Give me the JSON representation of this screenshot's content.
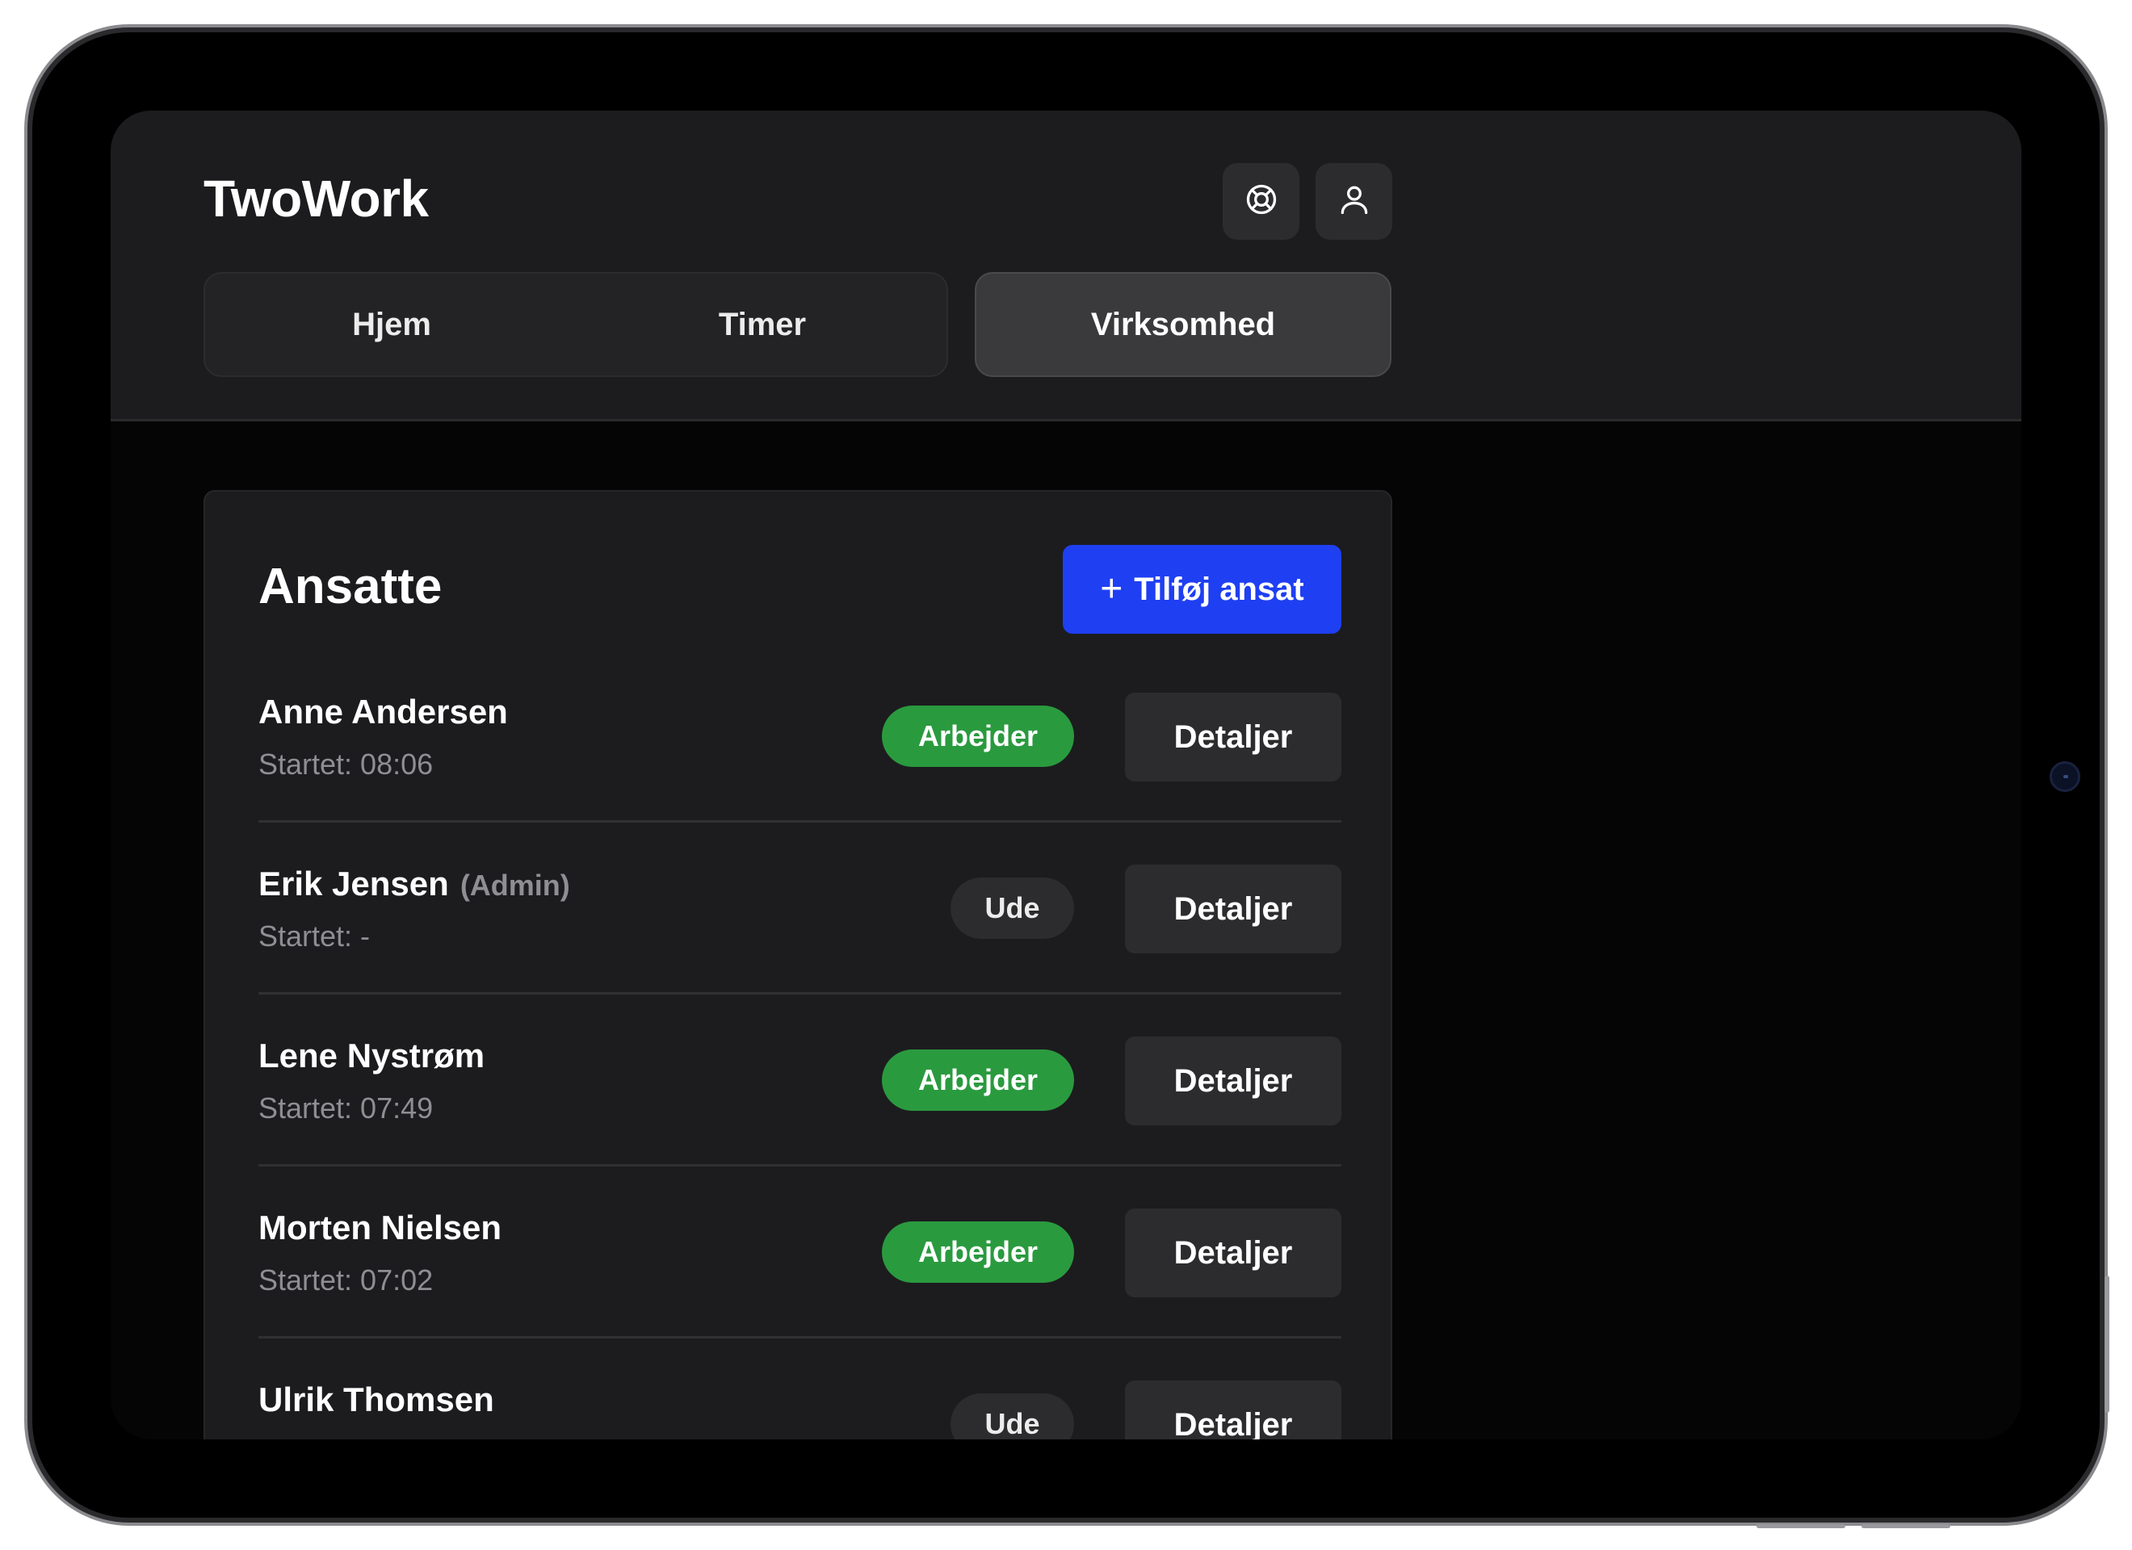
{
  "app": {
    "title": "TwoWork"
  },
  "header": {
    "support_icon": "lifebuoy-icon",
    "profile_icon": "user-icon"
  },
  "tabs": [
    {
      "label": "Hjem",
      "active": false
    },
    {
      "label": "Timer",
      "active": false
    },
    {
      "label": "Virksomhed",
      "active": true
    }
  ],
  "employees_card": {
    "title": "Ansatte",
    "add_button": {
      "icon": "+",
      "label": "Tilføj ansat"
    },
    "details_label": "Detaljer",
    "rows": [
      {
        "name": "Anne Andersen",
        "role": "",
        "started": "Startet: 08:06",
        "status": "Arbejder",
        "status_type": "working"
      },
      {
        "name": "Erik Jensen",
        "role": "(Admin)",
        "started": "Startet: -",
        "status": "Ude",
        "status_type": "out"
      },
      {
        "name": "Lene Nystrøm",
        "role": "",
        "started": "Startet: 07:49",
        "status": "Arbejder",
        "status_type": "working"
      },
      {
        "name": "Morten Nielsen",
        "role": "",
        "started": "Startet: 07:02",
        "status": "Arbejder",
        "status_type": "working"
      },
      {
        "name": "Ulrik Thomsen",
        "role": "",
        "started": "",
        "status": "Ude",
        "status_type": "out"
      }
    ]
  },
  "colors": {
    "accent": "#1f3ff2",
    "working": "#2a9a3f",
    "surface": "#1c1c1e",
    "background": "#050505"
  }
}
